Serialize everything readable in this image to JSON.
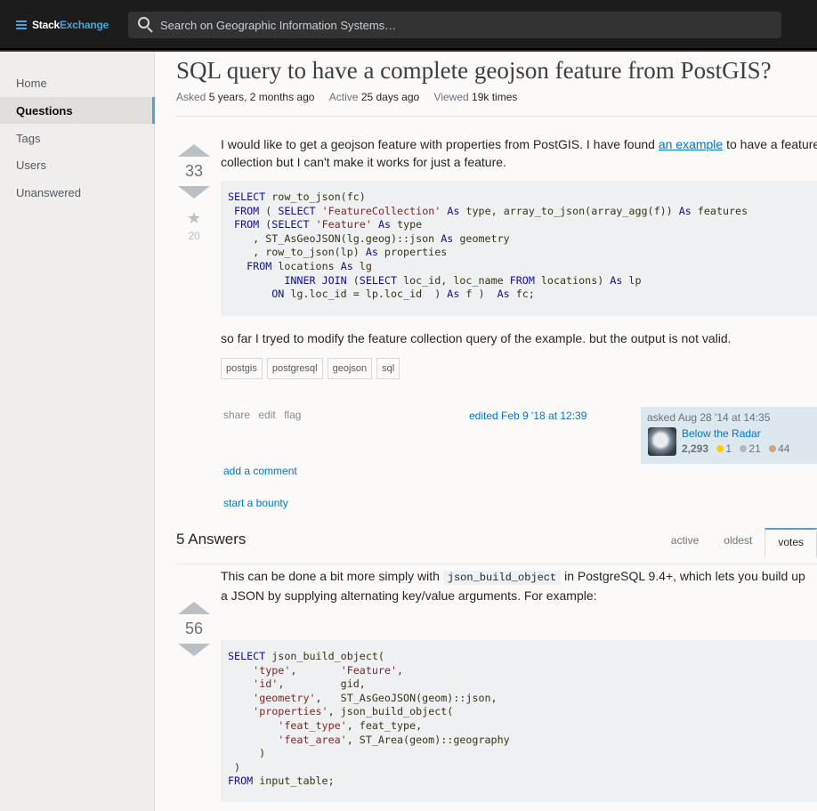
{
  "brand": {
    "part1": "Stack",
    "part2": "Exchange"
  },
  "search": {
    "placeholder": "Search on Geographic Information Systems…"
  },
  "nav": [
    "Home",
    "Questions",
    "Tags",
    "Users",
    "Unanswered"
  ],
  "question": {
    "title": "SQL query to have a complete geojson feature from PostGIS?",
    "meta": {
      "asked_label": "Asked",
      "asked_value": "5 years, 2 months ago",
      "active_label": "Active",
      "active_value": "25 days ago",
      "viewed_label": "Viewed",
      "viewed_value": "19k times"
    },
    "votes": "33",
    "favorites": "20",
    "body_part1": "I would like to get a geojson feature with properties from PostGIS. I have found ",
    "body_link": "an example",
    "body_part2": " to have a feature collection but I can't make it works for just a feature.",
    "body2": "so far I tryed to modify the feature collection query of the example. but the output is not valid.",
    "tags": [
      "postgis",
      "postgresql",
      "geojson",
      "sql"
    ],
    "menu": [
      "share",
      "edit",
      "flag"
    ],
    "edited": "edited Feb 9 '18 at 12:39",
    "owner": {
      "asked": "asked Aug 28 '14 at 14:35",
      "name": "Below the Radar",
      "rep": "2,293",
      "gold": "1",
      "silver": "21",
      "bronze": "44"
    },
    "add_comment": "add a comment",
    "bounty": "start a bounty"
  },
  "answers": {
    "header": "5 Answers",
    "sort_tabs": [
      "active",
      "oldest",
      "votes"
    ],
    "votes": "56",
    "text_part1": "This can be done a bit more simply with ",
    "text_code": "json_build_object",
    "text_part2": " in PostgreSQL 9.4+, which lets you build up a JSON by supplying alternating key/value arguments. For example:"
  },
  "code1": [
    [
      [
        "kw",
        "SELECT"
      ],
      [
        "t",
        " row_to_json(fc)"
      ]
    ],
    [
      [
        "t",
        " "
      ],
      [
        "kw",
        "FROM"
      ],
      [
        "t",
        " ( "
      ],
      [
        "kw",
        "SELECT"
      ],
      [
        "t",
        " "
      ],
      [
        "str",
        "'FeatureCollection'"
      ],
      [
        "t",
        " "
      ],
      [
        "kw",
        "As"
      ],
      [
        "t",
        " type, array_to_json(array_agg(f)) "
      ],
      [
        "kw",
        "As"
      ],
      [
        "t",
        " features"
      ]
    ],
    [
      [
        "t",
        " "
      ],
      [
        "kw",
        "FROM"
      ],
      [
        "t",
        " ("
      ],
      [
        "kw",
        "SELECT"
      ],
      [
        "t",
        " "
      ],
      [
        "str",
        "'Feature'"
      ],
      [
        "t",
        " "
      ],
      [
        "kw",
        "As"
      ],
      [
        "t",
        " type"
      ]
    ],
    [
      [
        "t",
        "    , ST_AsGeoJSON(lg.geog)::json "
      ],
      [
        "kw",
        "As"
      ],
      [
        "t",
        " geometry"
      ]
    ],
    [
      [
        "t",
        "    , row_to_json(lp) "
      ],
      [
        "kw",
        "As"
      ],
      [
        "t",
        " properties"
      ]
    ],
    [
      [
        "t",
        "   "
      ],
      [
        "kw",
        "FROM"
      ],
      [
        "t",
        " locations "
      ],
      [
        "kw",
        "As"
      ],
      [
        "t",
        " lg"
      ]
    ],
    [
      [
        "t",
        "         "
      ],
      [
        "kw",
        "INNER JOIN"
      ],
      [
        "t",
        " ("
      ],
      [
        "kw",
        "SELECT"
      ],
      [
        "t",
        " loc_id, loc_name "
      ],
      [
        "kw",
        "FROM"
      ],
      [
        "t",
        " locations) "
      ],
      [
        "kw",
        "As"
      ],
      [
        "t",
        " lp"
      ]
    ],
    [
      [
        "t",
        "       "
      ],
      [
        "kw",
        "ON"
      ],
      [
        "t",
        " lg.loc_id = lp.loc_id  ) "
      ],
      [
        "kw",
        "As"
      ],
      [
        "t",
        " f )  "
      ],
      [
        "kw",
        "As"
      ],
      [
        "t",
        " fc;"
      ]
    ]
  ],
  "code2": [
    [
      [
        "kw",
        "SELECT"
      ],
      [
        "t",
        " json_build_object("
      ]
    ],
    [
      [
        "t",
        "    "
      ],
      [
        "str",
        "'type'"
      ],
      [
        "t",
        ",       "
      ],
      [
        "str",
        "'Feature'"
      ],
      [
        "t",
        ","
      ]
    ],
    [
      [
        "t",
        "    "
      ],
      [
        "str",
        "'id'"
      ],
      [
        "t",
        ",         gid,"
      ]
    ],
    [
      [
        "t",
        "    "
      ],
      [
        "str",
        "'geometry'"
      ],
      [
        "t",
        ",   ST_AsGeoJSON(geom)::json,"
      ]
    ],
    [
      [
        "t",
        "    "
      ],
      [
        "str",
        "'properties'"
      ],
      [
        "t",
        ", json_build_object("
      ]
    ],
    [
      [
        "t",
        "        "
      ],
      [
        "str",
        "'feat_type'"
      ],
      [
        "t",
        ", feat_type,"
      ]
    ],
    [
      [
        "t",
        "        "
      ],
      [
        "str",
        "'feat_area'"
      ],
      [
        "t",
        ", ST_Area(geom)::geography"
      ]
    ],
    [
      [
        "t",
        "     )"
      ]
    ],
    [
      [
        "t",
        " )"
      ]
    ],
    [
      [
        "kw",
        "FROM"
      ],
      [
        "t",
        " input_table;"
      ]
    ]
  ]
}
